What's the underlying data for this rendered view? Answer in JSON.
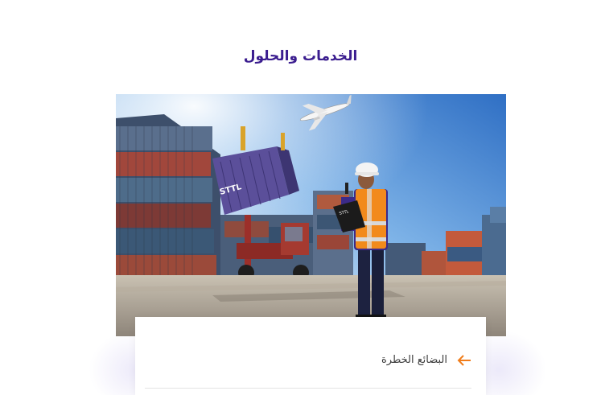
{
  "section": {
    "title": "الخدمات والحلول"
  },
  "hero": {
    "image_alt": "Cargo containers port with worker and airplane",
    "container_brand": "STTL"
  },
  "card": {
    "items": [
      {
        "label": "البضائع الخطرة",
        "icon": "arrow-left-icon"
      }
    ]
  },
  "colors": {
    "title": "#3b1d8f",
    "accent_orange": "#f07c1a",
    "sky_top": "#3a7fd0",
    "vest_orange": "#f28a1c"
  }
}
